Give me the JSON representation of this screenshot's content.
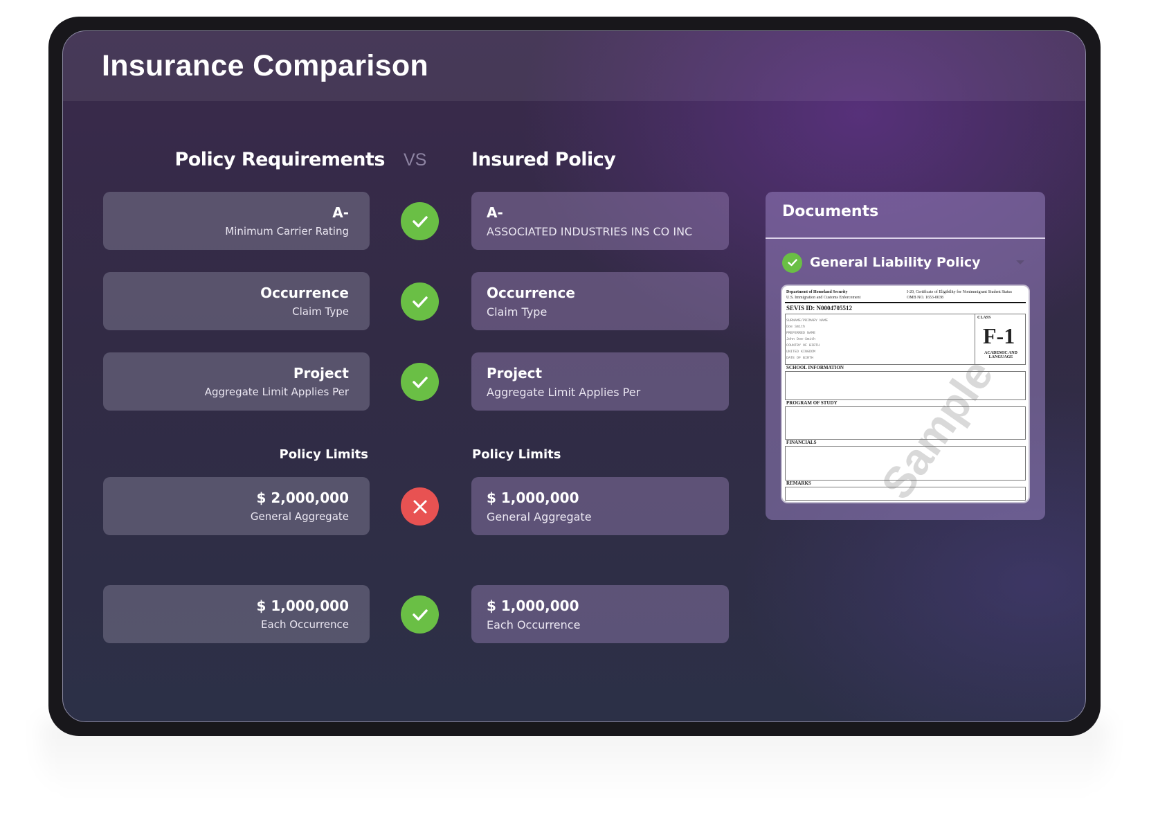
{
  "app": {
    "title": "Insurance Comparison"
  },
  "columns": {
    "requirements": "Policy Requirements",
    "vs": "VS",
    "insured": "Insured Policy"
  },
  "rows": [
    {
      "req_value": "A-",
      "req_label": "Minimum Carrier Rating",
      "status": "pass",
      "ins_value": "A-",
      "ins_label": "ASSOCIATED INDUSTRIES INS CO INC"
    },
    {
      "req_value": "Occurrence",
      "req_label": "Claim Type",
      "status": "pass",
      "ins_value": "Occurrence",
      "ins_label": "Claim Type"
    },
    {
      "req_value": "Project",
      "req_label": "Aggregate Limit Applies Per",
      "status": "pass",
      "ins_value": "Project",
      "ins_label": "Aggregate Limit Applies Per"
    }
  ],
  "limits": {
    "req_heading": "Policy Limits",
    "ins_heading": "Policy Limits",
    "rows": [
      {
        "req_value": "$ 2,000,000",
        "req_label": "General Aggregate",
        "status": "fail",
        "ins_value": "$ 1,000,000",
        "ins_label": "General Aggregate"
      },
      {
        "req_value": "$ 1,000,000",
        "req_label": "Each Occurrence",
        "status": "pass",
        "ins_value": "$ 1,000,000",
        "ins_label": "Each Occurrence"
      }
    ]
  },
  "documents": {
    "title": "Documents",
    "items": [
      {
        "name": "General Liability Policy",
        "status": "verified"
      }
    ],
    "preview": {
      "dept": "Department of Homeland Security",
      "agency": "U.S. Immigration and Customs Enforcement",
      "form": "I-20, Certificate of Eligibility for Nonimmigrant Student Status",
      "omb": "OMB NO. 1653-0038",
      "sevis": "SEVIS ID:  N0004705512",
      "class_label": "CLASS",
      "class_value": "F-1",
      "class_desc": "ACADEMIC AND LANGUAGE",
      "sections": [
        "SCHOOL INFORMATION",
        "PROGRAM OF STUDY",
        "FINANCIALS",
        "REMARKS"
      ],
      "watermark": "Sample"
    }
  },
  "colors": {
    "pass": "#6abf45",
    "fail": "#e85252"
  }
}
